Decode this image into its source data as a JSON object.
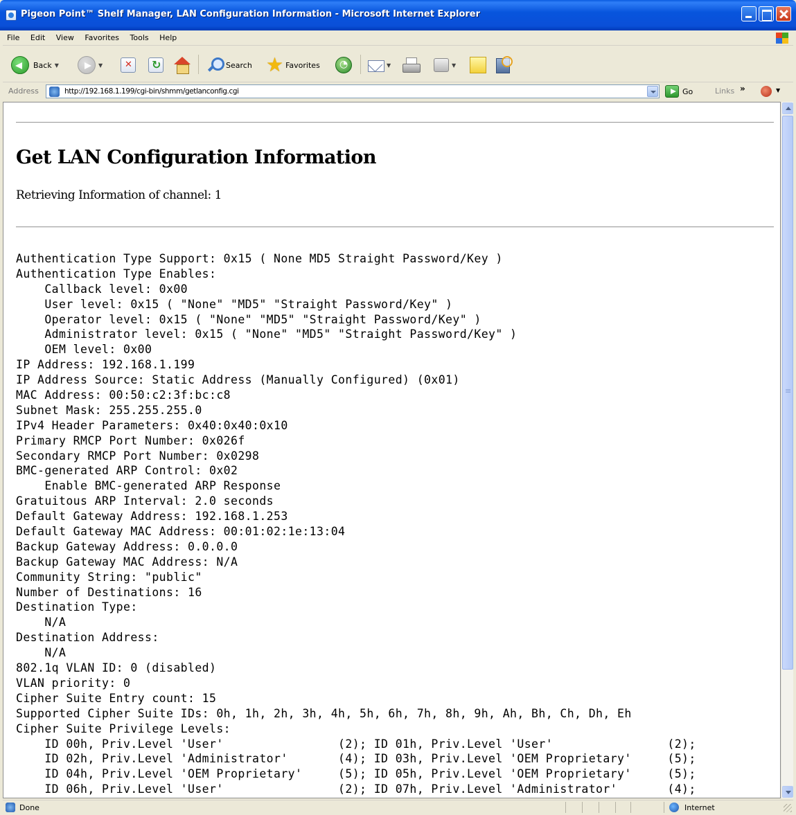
{
  "window": {
    "title": "Pigeon Point™ Shelf Manager, LAN Configuration Information - Microsoft Internet Explorer"
  },
  "menu": {
    "items": [
      "File",
      "Edit",
      "View",
      "Favorites",
      "Tools",
      "Help"
    ]
  },
  "toolbar": {
    "back_label": "Back",
    "search_label": "Search",
    "favorites_label": "Favorites"
  },
  "address_bar": {
    "label": "Address",
    "url": "http://192.168.1.199/cgi-bin/shmm/getlanconfig.cgi",
    "go_label": "Go",
    "links_label": "Links"
  },
  "page": {
    "heading": "Get LAN Configuration Information",
    "subtitle": "Retrieving Information of channel: 1",
    "lines": [
      "Authentication Type Support: 0x15 ( None MD5 Straight Password/Key )",
      "Authentication Type Enables:",
      "    Callback level: 0x00",
      "    User level: 0x15 ( \"None\" \"MD5\" \"Straight Password/Key\" )",
      "    Operator level: 0x15 ( \"None\" \"MD5\" \"Straight Password/Key\" )",
      "    Administrator level: 0x15 ( \"None\" \"MD5\" \"Straight Password/Key\" )",
      "    OEM level: 0x00",
      "IP Address: 192.168.1.199",
      "IP Address Source: Static Address (Manually Configured) (0x01)",
      "MAC Address: 00:50:c2:3f:bc:c8",
      "Subnet Mask: 255.255.255.0",
      "IPv4 Header Parameters: 0x40:0x40:0x10",
      "Primary RMCP Port Number: 0x026f",
      "Secondary RMCP Port Number: 0x0298",
      "BMC-generated ARP Control: 0x02",
      "    Enable BMC-generated ARP Response",
      "Gratuitous ARP Interval: 2.0 seconds",
      "Default Gateway Address: 192.168.1.253",
      "Default Gateway MAC Address: 00:01:02:1e:13:04",
      "Backup Gateway Address: 0.0.0.0",
      "Backup Gateway MAC Address: N/A",
      "Community String: \"public\"",
      "Number of Destinations: 16",
      "Destination Type:",
      "    N/A",
      "Destination Address:",
      "    N/A",
      "802.1q VLAN ID: 0 (disabled)",
      "VLAN priority: 0",
      "Cipher Suite Entry count: 15",
      "Supported Cipher Suite IDs: 0h, 1h, 2h, 3h, 4h, 5h, 6h, 7h, 8h, 9h, Ah, Bh, Ch, Dh, Eh",
      "Cipher Suite Privilege Levels:",
      "    ID 00h, Priv.Level 'User'                (2); ID 01h, Priv.Level 'User'                (2);",
      "    ID 02h, Priv.Level 'Administrator'       (4); ID 03h, Priv.Level 'OEM Proprietary'     (5);",
      "    ID 04h, Priv.Level 'OEM Proprietary'     (5); ID 05h, Priv.Level 'OEM Proprietary'     (5);",
      "    ID 06h, Priv.Level 'User'                (2); ID 07h, Priv.Level 'Administrator'       (4);"
    ]
  },
  "status_bar": {
    "status": "Done",
    "zone": "Internet"
  }
}
